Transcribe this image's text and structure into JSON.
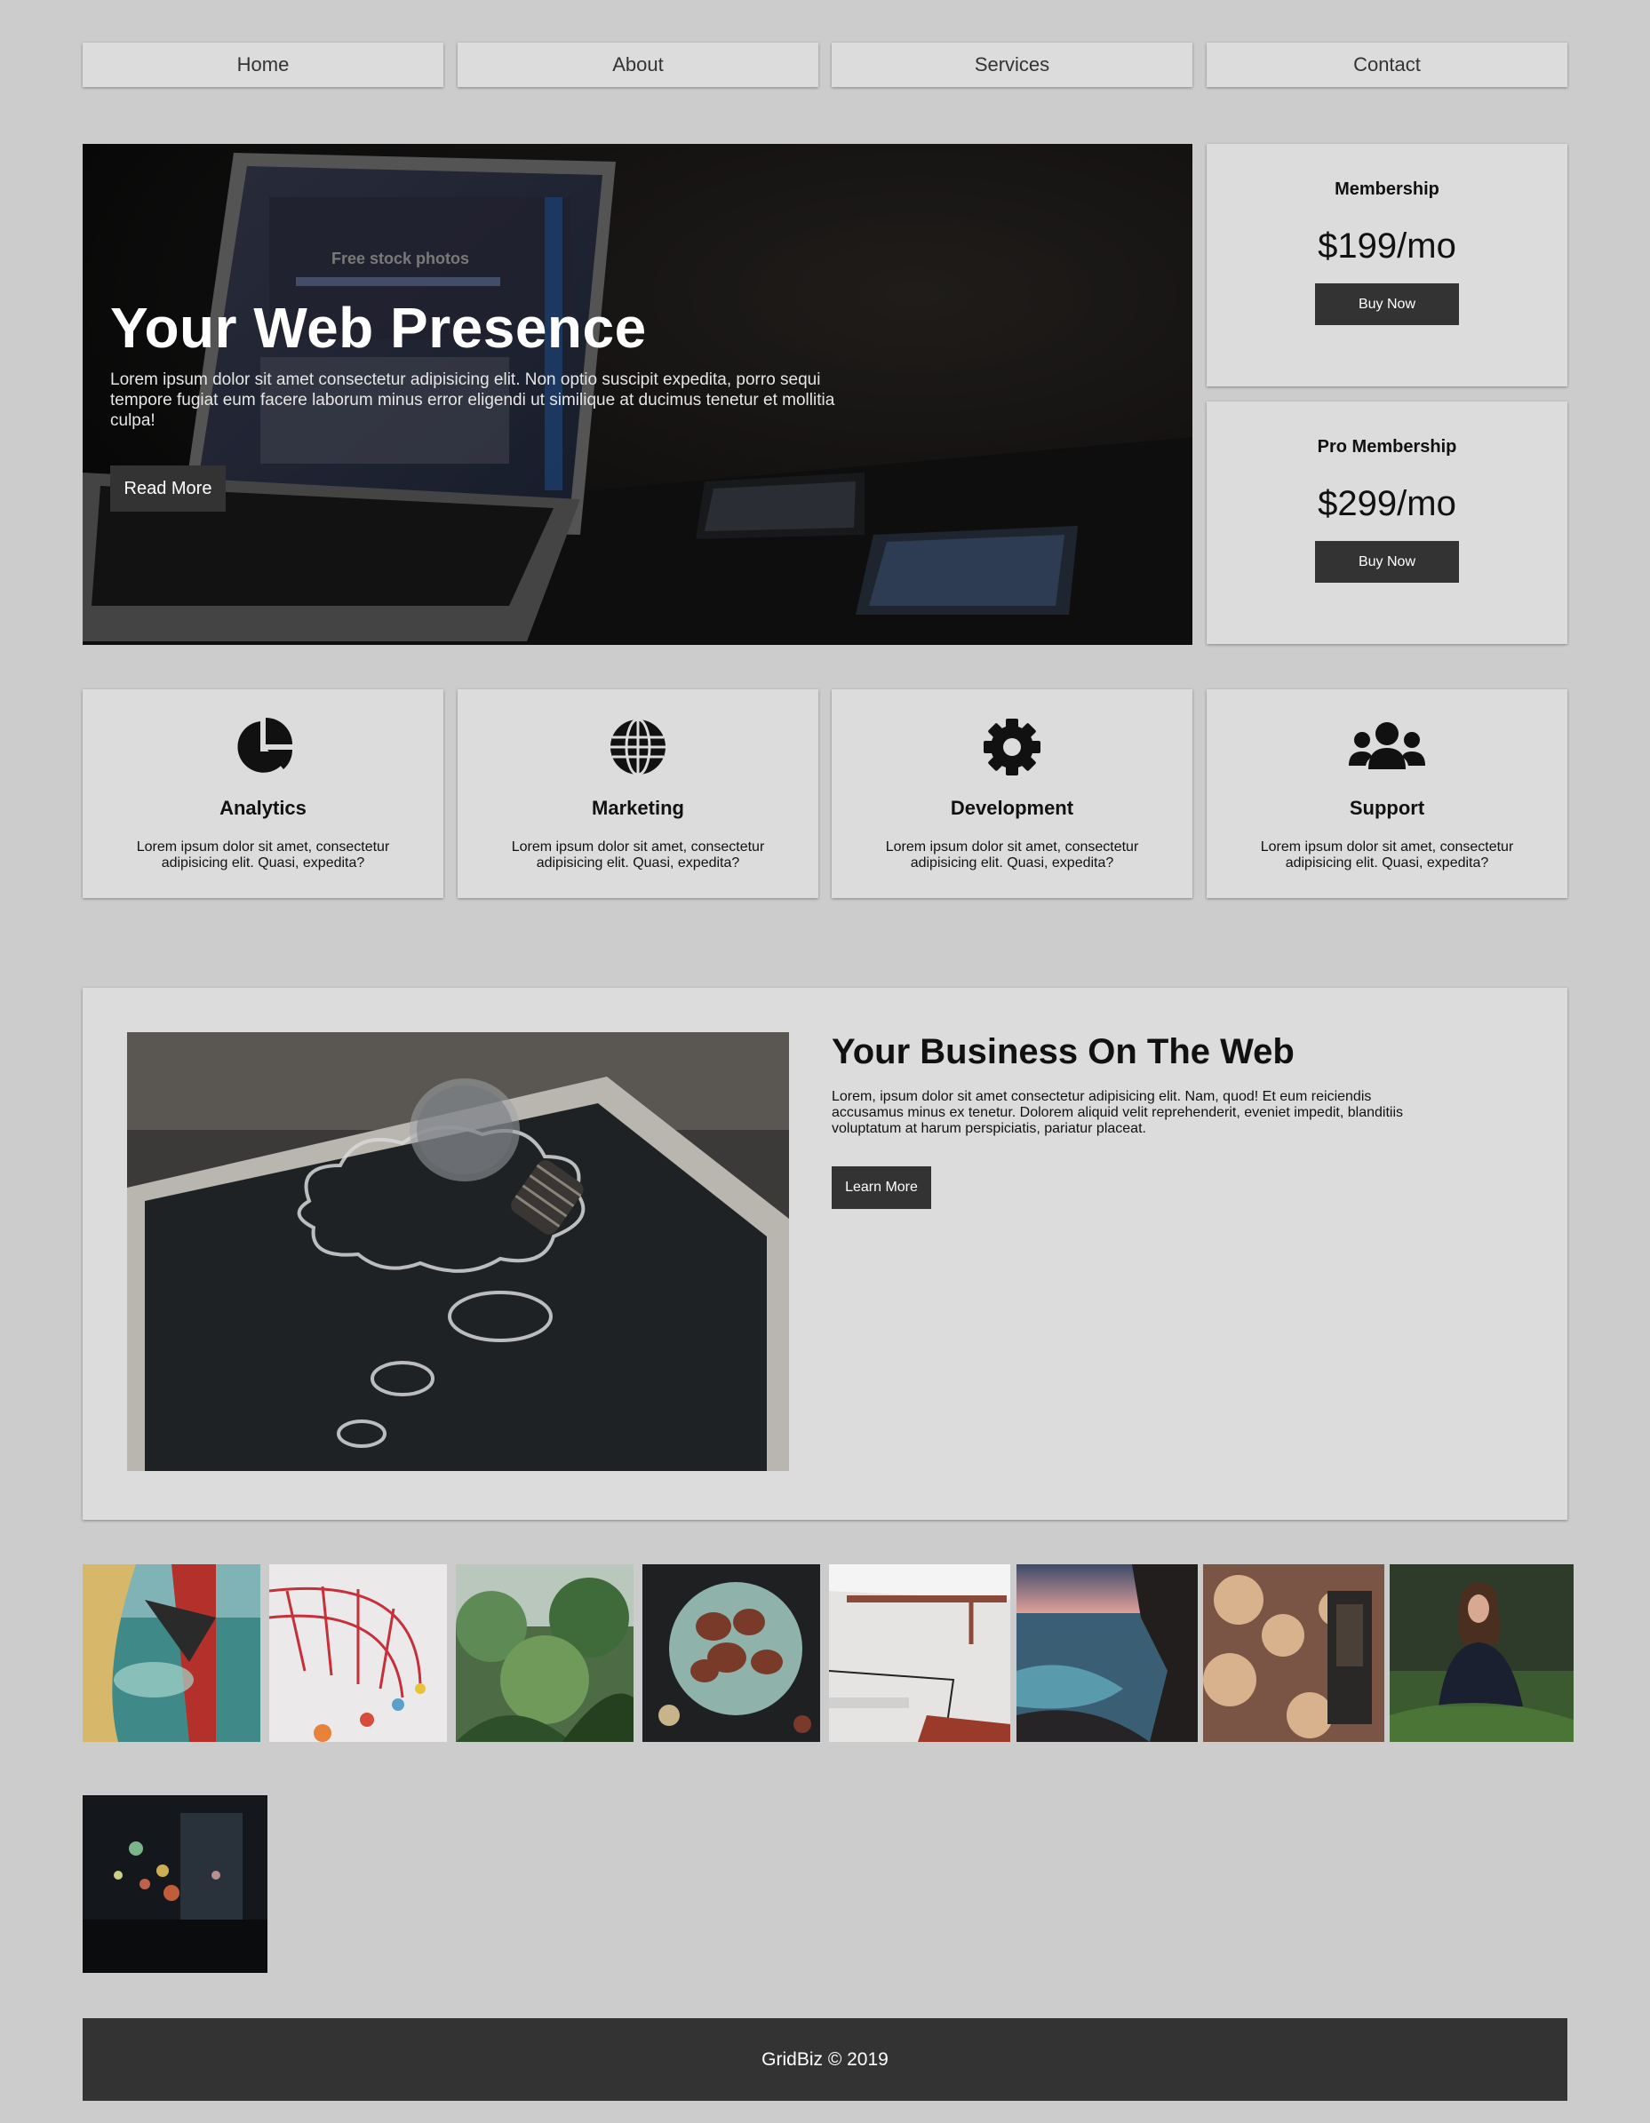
{
  "nav": {
    "items": [
      {
        "label": "Home"
      },
      {
        "label": "About"
      },
      {
        "label": "Services"
      },
      {
        "label": "Contact"
      }
    ]
  },
  "hero": {
    "title": "Your Web Presence",
    "text": "Lorem ipsum dolor sit amet consectetur adipisicing elit. Non optio suscipit expedita, porro sequi tempore fugiat eum facere laborum minus error eligendi ut similique at ducimus tenetur et mollitia culpa!",
    "button": "Read More",
    "screen_text": "Free stock photos"
  },
  "pricing": [
    {
      "name": "Membership",
      "price": "$199/mo",
      "button": "Buy Now"
    },
    {
      "name": "Pro Membership",
      "price": "$299/mo",
      "button": "Buy Now"
    }
  ],
  "services": [
    {
      "icon": "pie-chart-icon",
      "title": "Analytics",
      "text": "Lorem ipsum dolor sit amet, consectetur adipisicing elit. Quasi, expedita?"
    },
    {
      "icon": "globe-icon",
      "title": "Marketing",
      "text": "Lorem ipsum dolor sit amet, consectetur adipisicing elit. Quasi, expedita?"
    },
    {
      "icon": "gear-icon",
      "title": "Development",
      "text": "Lorem ipsum dolor sit amet, consectetur adipisicing elit. Quasi, expedita?"
    },
    {
      "icon": "users-icon",
      "title": "Support",
      "text": "Lorem ipsum dolor sit amet, consectetur adipisicing elit. Quasi, expedita?"
    }
  ],
  "business": {
    "title": "Your Business On The Web",
    "text": "Lorem, ipsum dolor sit amet consectetur adipisicing elit. Nam, quod! Et eum reiciendis accusamus minus ex tenetur. Dolorem aliquid velit reprehenderit, eveniet impedit, blanditiis voluptatum at harum perspiciatis, pariatur placeat.",
    "button": "Learn More"
  },
  "footer": {
    "text": "GridBiz © 2019"
  },
  "colors": {
    "page_bg": "#cccccc",
    "card_bg": "#dcdcdc",
    "button_bg": "#333333",
    "footer_bg": "#333333"
  }
}
